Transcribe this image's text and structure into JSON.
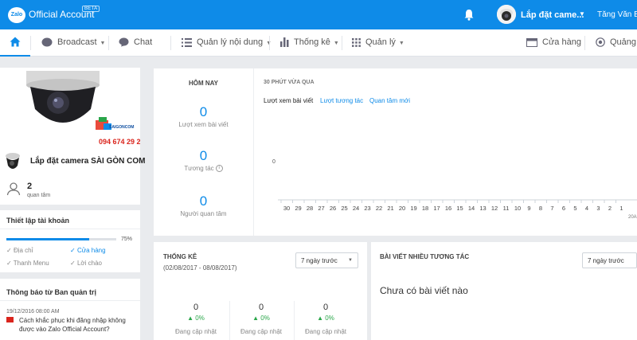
{
  "topbar": {
    "logo_text": "Zalo",
    "brand": "Official Account",
    "beta": "BETA",
    "account_name": "Lắp đặt came...",
    "user_name": "Tăng Văn Bì",
    "bg_color": "#0e8be8"
  },
  "nav": {
    "broadcast": "Broadcast",
    "chat": "Chat",
    "content": "Quản lý nội dung",
    "stats": "Thống kê",
    "manage": "Quản lý",
    "store": "Cửa hàng",
    "ads": "Quảng cá"
  },
  "profile": {
    "image_brand": "SAIGONCOM",
    "phone": "094 674 29 29",
    "name": "Lắp đặt camera SÀI GÒN COM",
    "followers": "2",
    "followers_label": "quan tâm"
  },
  "setup": {
    "title": "Thiết lập tài khoản",
    "progress": 0.75,
    "progress_label": "75%",
    "items": [
      "Địa chỉ",
      "Cửa hàng",
      "Thanh Menu",
      "Lời chào"
    ]
  },
  "notice": {
    "title": "Thông báo từ Ban quản trị",
    "date": "19/12/2016 08:00 AM",
    "text": "Cách khắc phục khi đăng nhập không được vào Zalo Official Account?"
  },
  "today": {
    "title": "HÔM NAY",
    "views_value": "0",
    "views_label": "Lượt xem bài viết",
    "interactions_value": "0",
    "interactions_label": "Tương tác",
    "followers_value": "0",
    "followers_label": "Người quan tâm",
    "chart_title": "30 PHÚT VỪA QUA",
    "tabs": [
      "Lượt xem bài viết",
      "Lượt tương tác",
      "Quan tâm mới"
    ]
  },
  "chart_data": {
    "type": "line",
    "x": [
      "30",
      "29",
      "28",
      "27",
      "26",
      "25",
      "24",
      "23",
      "22",
      "21",
      "20",
      "19",
      "18",
      "17",
      "16",
      "15",
      "14",
      "13",
      "12",
      "11",
      "10",
      "9",
      "8",
      "7",
      "6",
      "5",
      "4",
      "3",
      "2",
      "1"
    ],
    "values": [
      0,
      0,
      0,
      0,
      0,
      0,
      0,
      0,
      0,
      0,
      0,
      0,
      0,
      0,
      0,
      0,
      0,
      0,
      0,
      0,
      0,
      0,
      0,
      0,
      0,
      0,
      0,
      0,
      0,
      0
    ],
    "y_tick_label": "0",
    "x_suffix_label": "20A"
  },
  "stats": {
    "title": "THỐNG KÊ",
    "range": "(02/08/2017 - 08/08/2017)",
    "select": "7 ngày trước",
    "items": [
      {
        "value": "0",
        "pct": "0%",
        "label": "Đang cập nhật"
      },
      {
        "value": "0",
        "pct": "0%",
        "label": "Đang cập nhật"
      },
      {
        "value": "0",
        "pct": "0%",
        "label": "Đang cập nhật"
      }
    ]
  },
  "posts": {
    "title": "BÀI VIẾT NHIỀU TƯƠNG TÁC",
    "select": "7 ngày trước",
    "empty": "Chưa có bài viết nào"
  }
}
